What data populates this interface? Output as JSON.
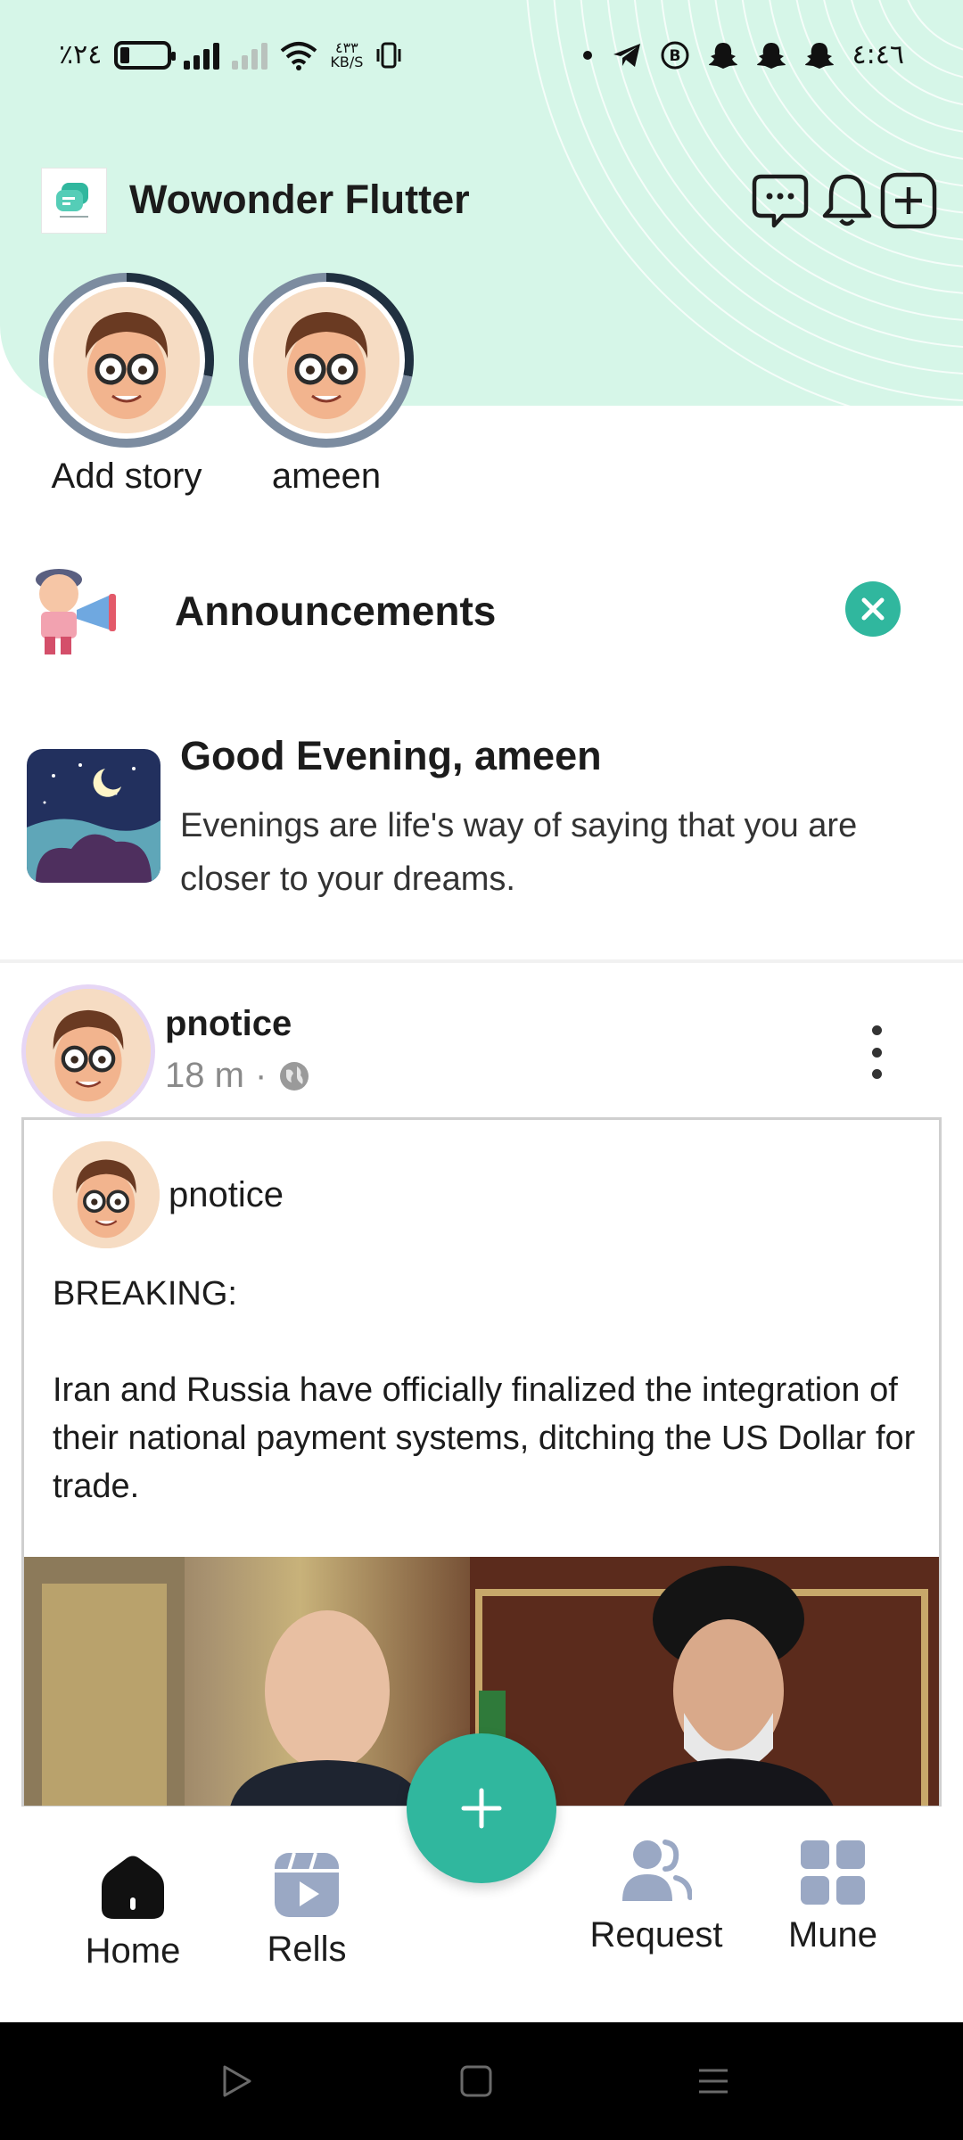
{
  "status_bar": {
    "battery": "٪٢٤",
    "speed_value": "٤٣٣",
    "speed_unit": "KB/S",
    "time": "٤:٤٦"
  },
  "app_bar": {
    "title": "Wowonder Flutter",
    "icons": [
      "chat-icon",
      "bell-icon",
      "add-square-icon"
    ]
  },
  "stories": [
    {
      "label": "Add story"
    },
    {
      "label": "ameen"
    }
  ],
  "announcement": {
    "title": "Announcements",
    "greeting_title": "Good Evening, ameen",
    "greeting_text": "Evenings are life's way of saying that you are closer to your dreams."
  },
  "post": {
    "username": "pnotice",
    "time": "18 m",
    "separator": "·",
    "shared_username": "pnotice",
    "text": "BREAKING:\n\nIran and Russia have officially finalized the integration of their national payment systems, ditching the US Dollar for trade."
  },
  "bottom_nav": {
    "items": [
      {
        "label": "Home",
        "icon": "home-icon"
      },
      {
        "label": "Rells",
        "icon": "reels-icon"
      },
      {
        "label": "Request",
        "icon": "users-icon"
      },
      {
        "label": "Mune",
        "icon": "grid-icon"
      }
    ]
  },
  "colors": {
    "accent": "#30b79e",
    "header_bg": "#d6f6e8"
  }
}
